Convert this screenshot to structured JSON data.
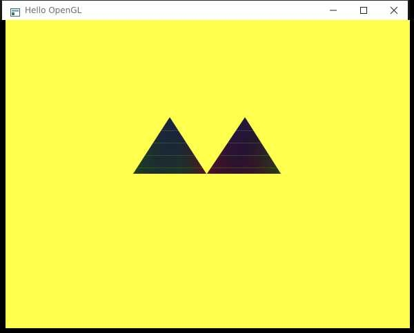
{
  "window": {
    "title": "Hello OpenGL",
    "buttons": {
      "minimize": "minimize-icon",
      "maximize": "maximize-icon",
      "close": "close-icon"
    }
  },
  "viewport": {
    "clear_color": "#ffff4d",
    "triangle_colors": {
      "top": "#1c1c5a",
      "bottom_left": "#1f4a12",
      "bottom_right": "#5a1020"
    }
  }
}
